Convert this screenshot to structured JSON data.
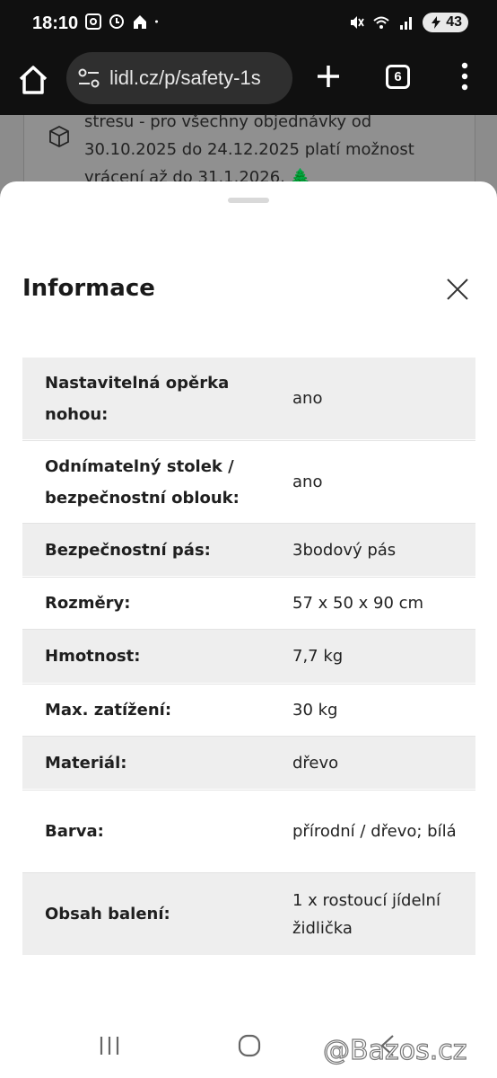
{
  "status_bar": {
    "time": "18:10",
    "battery": "43",
    "icons": [
      "screenshot-icon",
      "sync-icon",
      "home-status-icon",
      "dot-icon",
      "mute-icon",
      "wifi-icon",
      "signal-icon",
      "battery-icon"
    ]
  },
  "browser": {
    "url": "lidl.cz/p/safety-1s",
    "tab_count": "6",
    "icons": [
      "home-icon",
      "site-settings-icon",
      "plus-icon",
      "menu-dots-icon"
    ]
  },
  "background_page": {
    "promo_lines": [
      "stresu - pro všechny objednávky od",
      "30.10.2025 do 24.12.2025 platí možnost",
      "vrácení až do 31.1.2026. 🌲"
    ]
  },
  "sheet": {
    "title": "Informace",
    "close_icon": "close-icon",
    "specs": [
      {
        "key": "Nastavitelná opěrka nohou:",
        "value": "ano"
      },
      {
        "key": "Odnímatelný stolek / bezpečnostní oblouk:",
        "value": "ano"
      },
      {
        "key": "Bezpečnostní pás:",
        "value": "3bodový pás"
      },
      {
        "key": "Rozměry:",
        "value": "57 x 50 x 90 cm"
      },
      {
        "key": "Hmotnost:",
        "value": "7,7 kg"
      },
      {
        "key": "Max. zatížení:",
        "value": "30 kg"
      },
      {
        "key": "Materiál:",
        "value": "dřevo"
      },
      {
        "key": "Barva:",
        "value": "přírodní / dřevo; bílá"
      },
      {
        "key": "Obsah balení:",
        "value": "1 x rostoucí jídelní židlička"
      }
    ]
  },
  "nav_bar": {
    "icons": [
      "recents-icon",
      "home-circle-icon",
      "back-icon"
    ]
  },
  "watermark": "@Bazos.cz",
  "colors": {
    "status_bg": "#101010",
    "url_pill": "#2f2f2f",
    "row_shade": "#eeeeee",
    "scrim": "#8c8c8c"
  }
}
